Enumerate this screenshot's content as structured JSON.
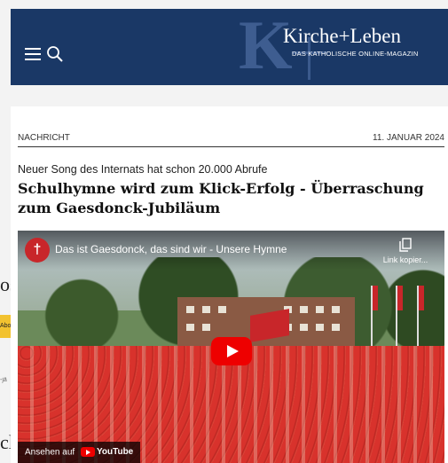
{
  "background_page": {
    "fragment_1": "os",
    "fragment_button": "Abo",
    "fragment_small": "-jä",
    "fragment_bottom": "cl"
  },
  "header": {
    "logo_title": "Kirche+Leben",
    "logo_subtitle": "DAS KATHOLISCHE ONLINE-MAGAZIN",
    "logo_monogram": "K",
    "brand_color": "#1a3866"
  },
  "article": {
    "category": "NACHRICHT",
    "date": "11. JANUAR 2024",
    "kicker": "Neuer Song des Internats hat schon 20.000 Abrufe",
    "headline": "Schulhymne wird zum Klick-Erfolg - Überraschung zum Gaesdonck-Jubiläum"
  },
  "video": {
    "channel_avatar_glyph": "†",
    "title": "Das ist Gaesdonck, das sind wir - Unsere Hymne",
    "copy_link_label": "Link kopier...",
    "watch_on_label": "Ansehen auf",
    "platform_label": "YouTube",
    "play_color": "#ee0000"
  }
}
